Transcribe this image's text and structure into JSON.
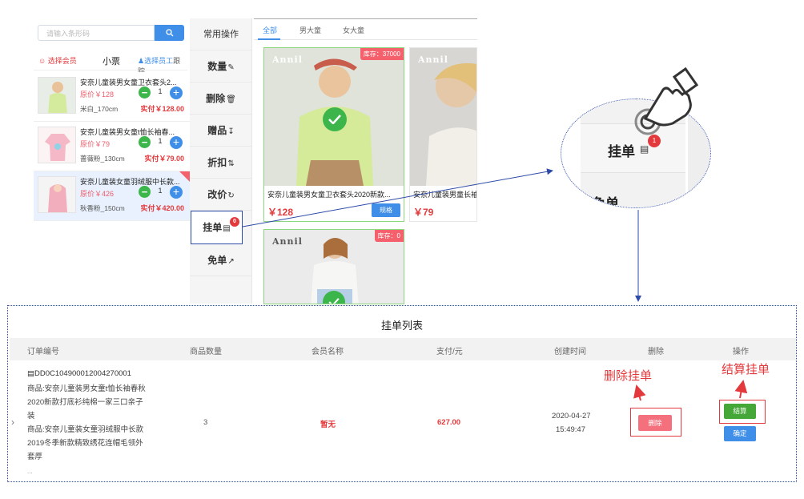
{
  "search": {
    "placeholder": "请输入条形码"
  },
  "cart": {
    "member_link": "选择会员",
    "title": "小票",
    "staff_link": "选择员工",
    "staff_tail": "跟踪",
    "items": [
      {
        "title": "安奈儿童装男女童卫衣套头2...",
        "price": "原价￥128",
        "spec": "米白_170cm",
        "qty": "1",
        "total": "实付￥128.00"
      },
      {
        "title": "安奈儿童装男女童t恤长袖春...",
        "price": "原价￥79",
        "spec": "蔷薇粉_130cm",
        "qty": "1",
        "total": "实付￥79.00"
      },
      {
        "title": "安奈儿童装女童羽绒服中长款...",
        "price": "原价￥426",
        "spec": "秋香粉_150cm",
        "qty": "1",
        "total": "实付￥420.00"
      }
    ]
  },
  "menu": {
    "common": "常用操作",
    "items": [
      "数量",
      "删除",
      "赠品",
      "折扣",
      "改价",
      "挂单",
      "免单"
    ],
    "hold_badge": "0"
  },
  "tabs": [
    "全部",
    "男大童",
    "女大童"
  ],
  "products": [
    {
      "brand": "Annil",
      "stock": "库存：37000",
      "name": "安奈儿童装男女童卫衣套头2020新款...",
      "price": "￥128",
      "spec_btn": "规格"
    },
    {
      "brand": "Annil",
      "stock": "",
      "name": "安奈儿童装男童长袖",
      "price": "￥79",
      "spec_btn": ""
    },
    {
      "brand": "Annil",
      "stock": "库存：0",
      "name": "",
      "price": "",
      "spec_btn": ""
    }
  ],
  "zoom": {
    "hold_label": "挂单",
    "badge": "1",
    "free_label": "免单"
  },
  "panel": {
    "title": "挂单列表",
    "headers": [
      "订单编号",
      "商品数量",
      "会员名称",
      "支付/元",
      "创建时间",
      "删除",
      "操作"
    ],
    "order_id": "DD0C104900012004270001",
    "goods": [
      "商品:安奈儿童装男女童t恤长袖春秋2020新款打底衫纯棉一家三口亲子装",
      "商品:安奈儿童装女童羽绒服中长款2019冬季新款精致绣花连帽毛领外套厚"
    ],
    "ellipsis": "...",
    "count": "3",
    "member": "暂无",
    "pay": "627.00",
    "date": "2020-04-27",
    "time": "15:49:47",
    "delete_btn": "删除",
    "settle_btn": "结算",
    "confirm_btn": "确定",
    "anno_delete": "删除挂单",
    "anno_settle": "结算挂单"
  },
  "colors": {
    "accent": "#3f8fe8",
    "danger": "#e4393c",
    "success": "#44a737"
  }
}
